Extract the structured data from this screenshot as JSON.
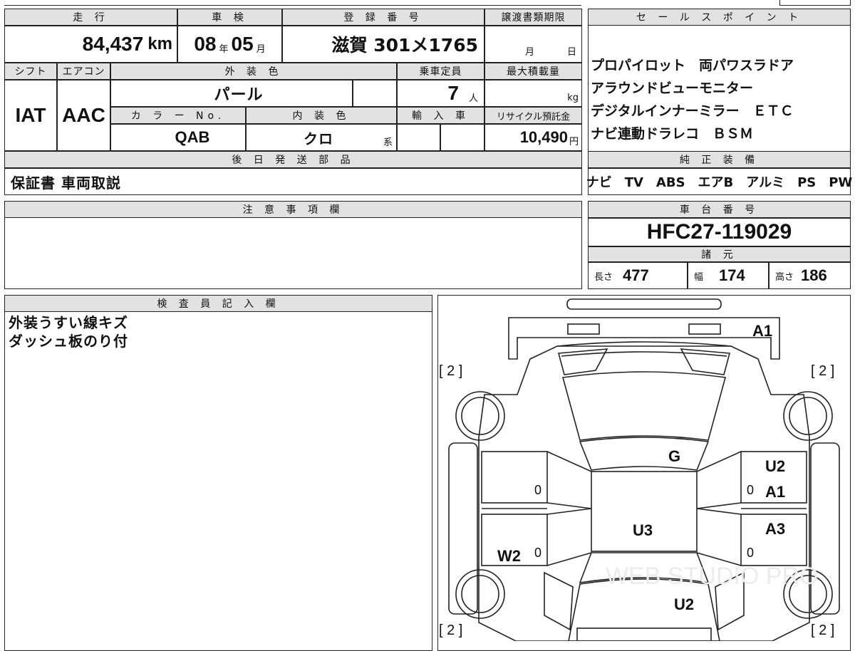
{
  "header": {
    "mileage_label": "走 行",
    "inspection_label": "車 検",
    "reg_number_label": "登 録 番 号",
    "transfer_deadline_label": "譲渡書類期限",
    "sales_point_label": "セ ー ル ス ポ イ ン ト"
  },
  "vehicle": {
    "mileage_value": "84,437",
    "mileage_unit": "km",
    "inspection_year": "08",
    "inspection_year_unit": "年",
    "inspection_month": "05",
    "inspection_month_unit": "月",
    "reg_number": "滋賀 301メ1765",
    "transfer_month_unit": "月",
    "transfer_day_unit": "日",
    "shift_label": "シフト",
    "ac_label": "エアコン",
    "exterior_color_label": "外 装 色",
    "capacity_label": "乗車定員",
    "max_load_label": "最大積載量",
    "shift_value": "IAT",
    "ac_value": "AAC",
    "exterior_color_value": "パール",
    "capacity_value": "7",
    "capacity_unit": "人",
    "max_load_unit": "kg",
    "color_no_label": "カ ラ ー No.",
    "interior_color_label": "内 装 色",
    "import_label": "輸 入 車",
    "recycle_label": "リサイクル預託金",
    "color_no_value": "QAB",
    "interior_color_value": "クロ",
    "interior_color_unit": "系",
    "recycle_value": "10,490",
    "recycle_unit": "円",
    "later_parts_label": "後 日 発 送 部 品",
    "later_parts_value": "保証書 車両取説"
  },
  "sales_points": [
    "プロパイロット　両パワスラドア",
    "アラウンドビューモニター",
    "デジタルインナーミラー　ＥＴＣ",
    "ナビ連動ドラレコ　ＢＳＭ"
  ],
  "equipment": {
    "label": "純 正 装 備",
    "value": "ナビ　TV　ABS　エアB　アルミ　PS　PW"
  },
  "notes": {
    "label": "注 意 事 項 欄",
    "value": ""
  },
  "chassis": {
    "label": "車 台 番 号",
    "value": "HFC27-119029"
  },
  "specs": {
    "label": "諸 元",
    "length_label": "長さ",
    "length_value": "477",
    "width_label": "幅",
    "width_value": "174",
    "height_label": "高さ",
    "height_value": "186"
  },
  "inspector": {
    "label": "検 査 員 記 入 欄",
    "lines": [
      "外装うすい線キズ",
      "ダッシュ板のり付"
    ]
  },
  "diagram": {
    "tire_mark": "[ 2 ]",
    "zero": "0",
    "labels": {
      "front_bumper": "A1",
      "windshield": "G",
      "roof": "U3",
      "rear_left": "W2",
      "rear": "U2",
      "right_front_1": "U2",
      "right_front_2": "A1",
      "right_rear": "A3"
    },
    "watermark": "WEB STUDIO PRO"
  }
}
